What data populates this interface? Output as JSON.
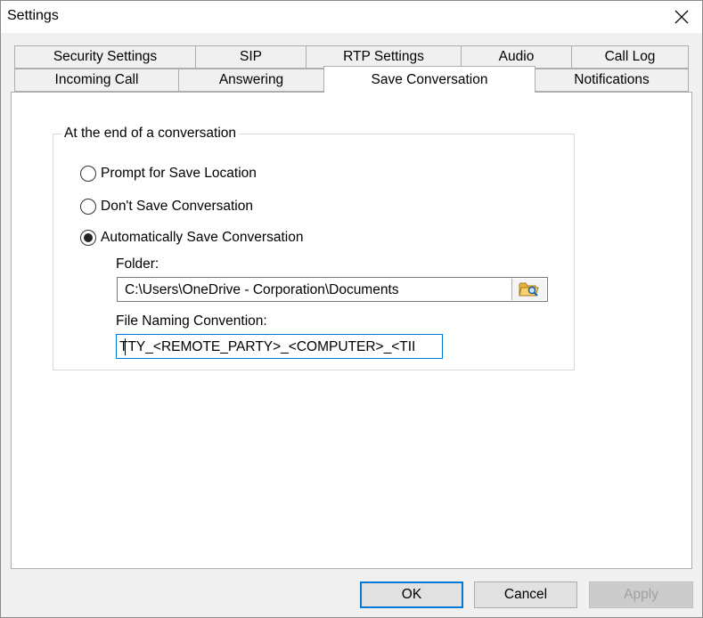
{
  "window": {
    "title": "Settings"
  },
  "tabs": {
    "row1": [
      "Security Settings",
      "SIP",
      "RTP Settings",
      "Audio",
      "Call Log"
    ],
    "row2": [
      "Incoming Call",
      "Answering",
      "Save Conversation",
      "Notifications"
    ],
    "active": "Save Conversation"
  },
  "group": {
    "title": "At the end of a conversation",
    "options": [
      {
        "label": "Prompt for Save Location",
        "selected": false
      },
      {
        "label": "Don't Save Conversation",
        "selected": false
      },
      {
        "label": "Automatically Save Conversation",
        "selected": true
      }
    ],
    "folder_label": "Folder:",
    "folder_value": "C:\\Users\\OneDrive -  Corporation\\Documents",
    "naming_label": "File Naming Convention:",
    "naming_value": "TTY_<REMOTE_PARTY>_<COMPUTER>_<TII"
  },
  "buttons": {
    "ok": "OK",
    "cancel": "Cancel",
    "apply": "Apply"
  },
  "icons": {
    "close": "close-icon",
    "browse": "folder-browse-icon"
  },
  "colors": {
    "focus": "#0078d7",
    "folder_icon": "#e8b53a"
  }
}
